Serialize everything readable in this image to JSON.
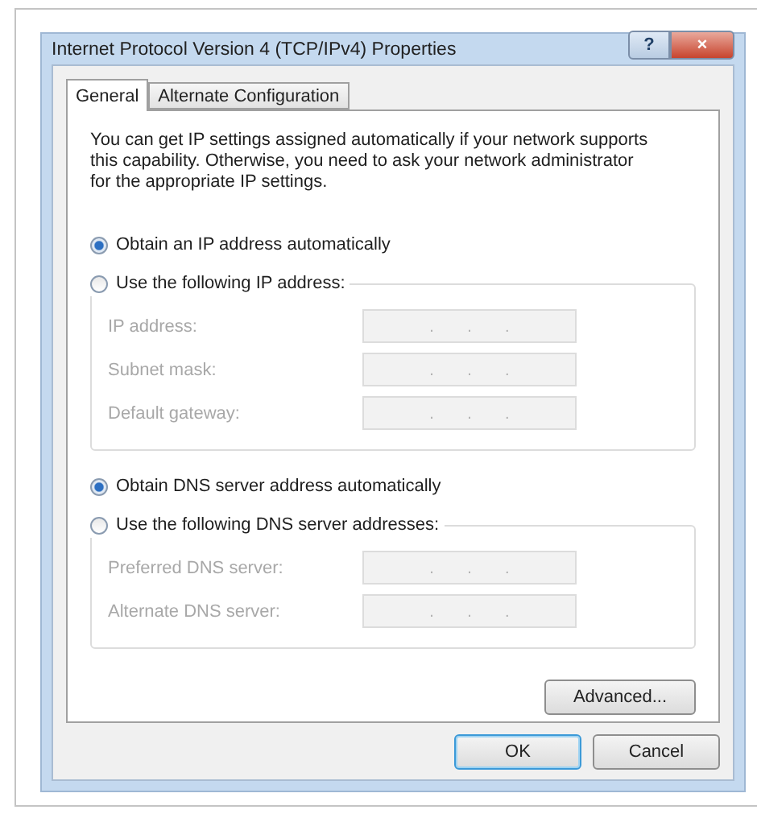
{
  "window": {
    "title": "Internet Protocol Version 4 (TCP/IPv4) Properties",
    "help_button": "?",
    "close_button": "×"
  },
  "tabs": [
    {
      "label": "General",
      "selected": true
    },
    {
      "label": "Alternate Configuration",
      "selected": false
    }
  ],
  "description": "You can get IP settings assigned automatically if your network supports this capability. Otherwise, you need to ask your network administrator for the appropriate IP settings.",
  "ip_options": [
    {
      "label": "Obtain an IP address automatically",
      "selected": true
    },
    {
      "label": "Use the following IP address:",
      "selected": false
    }
  ],
  "ip_fields": [
    {
      "label": "IP address:",
      "disabled": true,
      "separators": [
        ".",
        ".",
        "."
      ]
    },
    {
      "label": "Subnet mask:",
      "disabled": true,
      "separators": [
        ".",
        ".",
        "."
      ]
    },
    {
      "label": "Default gateway:",
      "disabled": true,
      "separators": [
        ".",
        ".",
        "."
      ]
    }
  ],
  "dns_options": [
    {
      "label": "Obtain DNS server address automatically",
      "selected": true
    },
    {
      "label": "Use the following DNS server addresses:",
      "selected": false
    }
  ],
  "dns_fields": [
    {
      "label": "Preferred DNS server:",
      "disabled": true,
      "separators": [
        ".",
        ".",
        "."
      ]
    },
    {
      "label": "Alternate DNS server:",
      "disabled": true,
      "separators": [
        ".",
        ".",
        "."
      ]
    }
  ],
  "advanced_button": "Advanced...",
  "buttons": [
    {
      "label": "OK",
      "kind": "default"
    },
    {
      "label": "Cancel",
      "kind": "normal"
    }
  ]
}
